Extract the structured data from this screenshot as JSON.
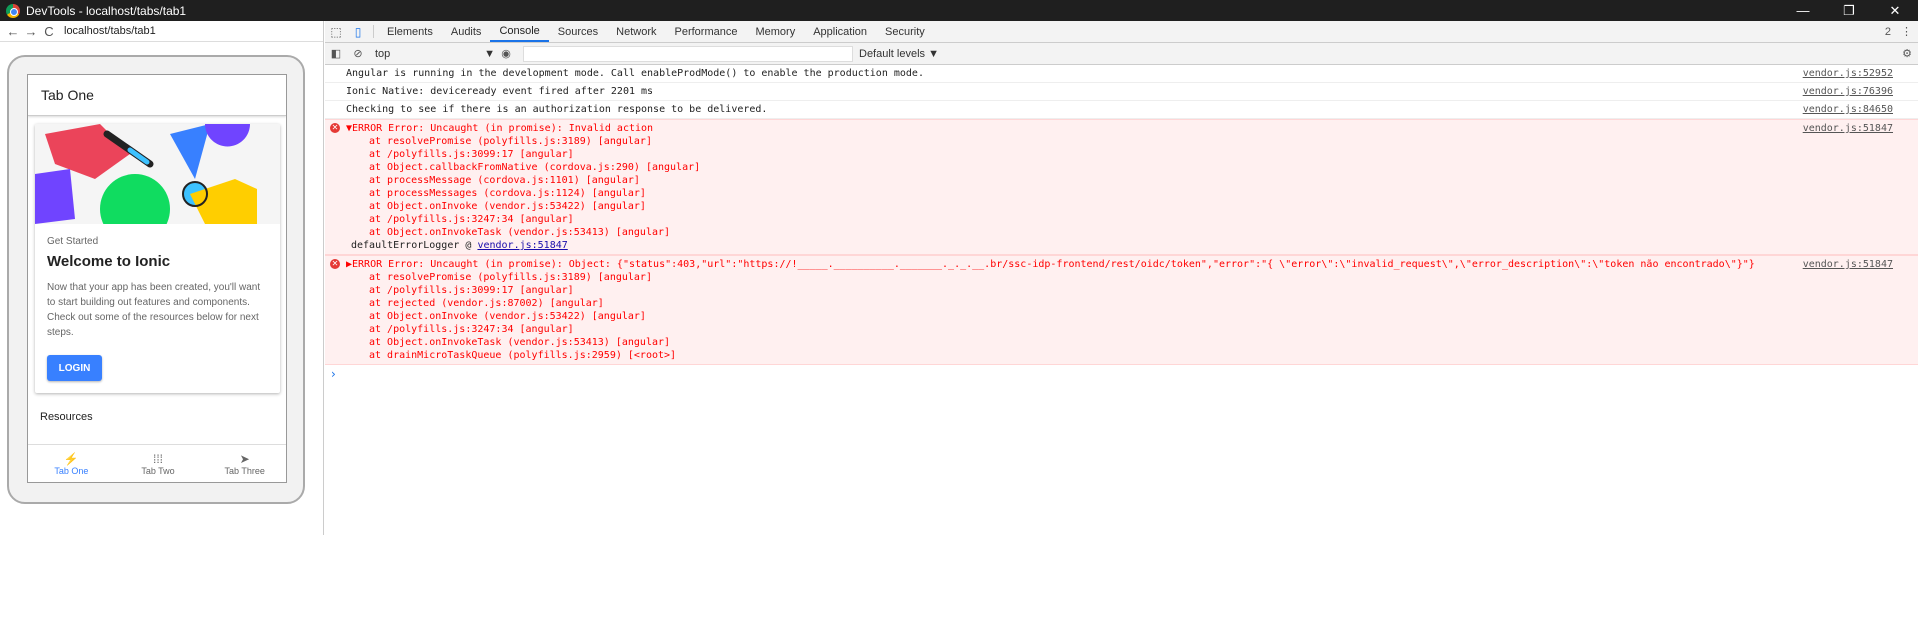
{
  "window": {
    "title": "DevTools - localhost/tabs/tab1",
    "buttons": [
      "—",
      "❐",
      "✕"
    ]
  },
  "emulator": {
    "url": "localhost/tabs/tab1",
    "nav": [
      "←",
      "→",
      "C"
    ],
    "app": {
      "toolbar_title": "Tab One",
      "card_subtitle": "Get Started",
      "card_title": "Welcome to Ionic",
      "card_body": "Now that your app has been created, you'll want to start building out features and components. Check out some of the resources below for next steps.",
      "login_label": "LOGIN",
      "resources_label": "Resources",
      "tabs": [
        {
          "label": "Tab One",
          "icon": "⚡",
          "icon_name": "flash-icon",
          "active": true
        },
        {
          "label": "Tab Two",
          "icon": "⁞⁞⁞",
          "icon_name": "apps-icon",
          "active": false
        },
        {
          "label": "Tab Three",
          "icon": "➤",
          "icon_name": "send-icon",
          "active": false
        }
      ]
    }
  },
  "devtools": {
    "tabs": [
      "Elements",
      "Audits",
      "Console",
      "Sources",
      "Network",
      "Performance",
      "Memory",
      "Application",
      "Security"
    ],
    "active_tab": "Console",
    "issue_count": "2",
    "more": "⋮",
    "context": "top",
    "context_arrow": "▼",
    "levels": "Default levels ▼",
    "messages": [
      {
        "text": "Angular is running in the development mode. Call enableProdMode() to enable the production mode.",
        "source": "vendor.js:52952"
      },
      {
        "text": "Ionic Native: deviceready event fired after 2201 ms",
        "source": "vendor.js:76396"
      },
      {
        "text": "Checking to see if there is an authorization response to be delivered.",
        "source": "vendor.js:84650"
      }
    ],
    "errors": [
      {
        "headline": "▼ERROR Error: Uncaught (in promise): Invalid action",
        "source": "vendor.js:51847",
        "stack": [
          "at resolvePromise (polyfills.js:3189) [angular]",
          "at /polyfills.js:3099:17 [angular]",
          "at Object.callbackFromNative (cordova.js:290) [angular]",
          "at processMessage (cordova.js:1101) [angular]",
          "at processMessages (cordova.js:1124) [angular]",
          "at Object.onInvoke (vendor.js:53422) [angular]",
          "at /polyfills.js:3247:34 [angular]",
          "at Object.onInvokeTask (vendor.js:53413) [angular]"
        ],
        "logger_label": "defaultErrorLogger @",
        "logger_link": "vendor.js:51847"
      },
      {
        "headline": "▶ERROR Error: Uncaught (in promise): Object: {\"status\":403,\"url\":\"https://!_____.__________._______._._.__.br/ssc-idp-frontend/rest/oidc/token\",\"error\":\"{ \\\"error\\\":\\\"invalid_request\\\",\\\"error_description\\\":\\\"token não encontrado\\\"}\"}",
        "source": "vendor.js:51847",
        "stack": [
          "at resolvePromise (polyfills.js:3189) [angular]",
          "at /polyfills.js:3099:17 [angular]",
          "at rejected (vendor.js:87002) [angular]",
          "at Object.onInvoke (vendor.js:53422) [angular]",
          "at /polyfills.js:3247:34 [angular]",
          "at Object.onInvokeTask (vendor.js:53413) [angular]",
          "at drainMicroTaskQueue (polyfills.js:2959) [<root>]"
        ]
      }
    ],
    "prompt": "›"
  },
  "colors": {
    "accent": "#3880ff",
    "error_bg": "#fff0f0",
    "error_text": "#ff0000",
    "titlebar": "#1f1f1f"
  }
}
